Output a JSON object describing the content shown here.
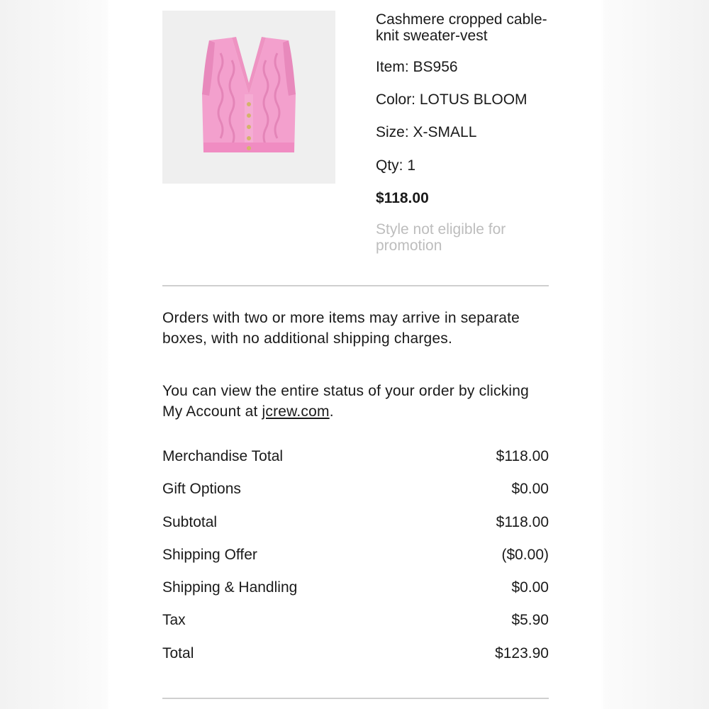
{
  "product": {
    "image_icon": "pink-cable-knit-vest-image",
    "name": "Cashmere cropped cable-knit sweater-vest",
    "item": "Item: BS956",
    "color": "Color: LOTUS BLOOM",
    "size": "Size: X-SMALL",
    "qty": "Qty: 1",
    "price": "$118.00",
    "promo_note": "Style not eligible for promotion"
  },
  "notes": {
    "shipping_note": "Orders with two or more items may arrive in separate boxes, with no additional shipping charges.",
    "status_prefix": "You can view the entire status of your order by clicking My Account at ",
    "status_link": "jcrew.com",
    "status_suffix": "."
  },
  "totals": [
    {
      "label": "Merchandise Total",
      "value": "$118.00"
    },
    {
      "label": "Gift Options",
      "value": "$0.00"
    },
    {
      "label": "Subtotal",
      "value": "$118.00"
    },
    {
      "label": "Shipping Offer",
      "value": "($0.00)"
    },
    {
      "label": "Shipping & Handling",
      "value": "$0.00"
    },
    {
      "label": "Tax",
      "value": "$5.90"
    },
    {
      "label": "Total",
      "value": "$123.90"
    }
  ],
  "colors": {
    "background": "#ffffff",
    "text": "#1a1a1a",
    "muted_text": "#bdbdbd",
    "divider": "#cfcfcf",
    "product_pink": "#f18fc6",
    "image_bg": "#efefef"
  }
}
